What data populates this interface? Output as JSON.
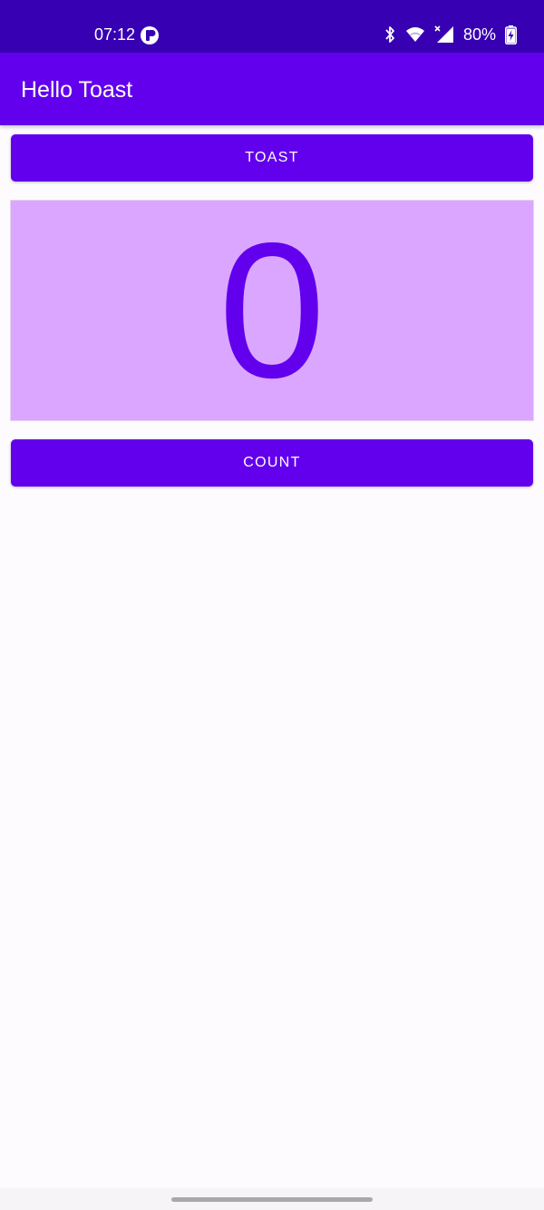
{
  "status_bar": {
    "time": "07:12",
    "battery_percent": "80%",
    "background_color": "#3700b3",
    "icons": [
      "app-notification-icon",
      "bluetooth-icon",
      "wifi-icon",
      "cell-signal-icon",
      "battery-charging-icon"
    ]
  },
  "app_bar": {
    "title": "Hello Toast",
    "background_color": "#6200ee"
  },
  "buttons": {
    "toast_label": "TOAST",
    "count_label": "COUNT"
  },
  "counter": {
    "value": "0",
    "background_color": "#dba6ff",
    "text_color": "#6200ee"
  }
}
